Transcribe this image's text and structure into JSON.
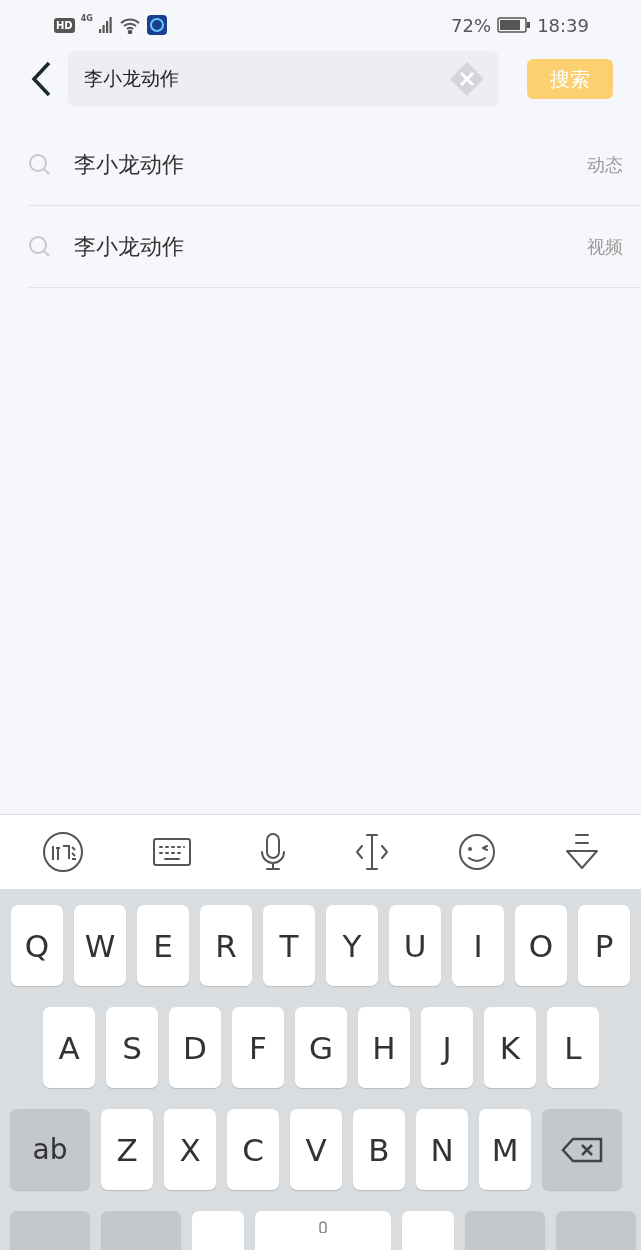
{
  "status_bar": {
    "hd": "HD",
    "network": "4G",
    "battery": "72%",
    "time": "18:39"
  },
  "search": {
    "value": "李小龙动作",
    "button": {
      "label": "搜索",
      "disabled": true
    }
  },
  "results": [
    {
      "text": "李小龙动作",
      "category": "动态"
    },
    {
      "text": "李小龙动作",
      "category": "视频"
    }
  ],
  "keyboard": {
    "rows": [
      [
        {
          "kind": "letter",
          "label": "Q"
        },
        {
          "kind": "letter",
          "label": "W"
        },
        {
          "kind": "letter",
          "label": "E"
        },
        {
          "kind": "letter",
          "label": "R"
        },
        {
          "kind": "letter",
          "label": "T"
        },
        {
          "kind": "letter",
          "label": "Y"
        },
        {
          "kind": "letter",
          "label": "U"
        },
        {
          "kind": "letter",
          "label": "I"
        },
        {
          "kind": "letter",
          "label": "O"
        },
        {
          "kind": "letter",
          "label": "P"
        }
      ],
      [
        {
          "kind": "letter",
          "label": "A"
        },
        {
          "kind": "letter",
          "label": "S"
        },
        {
          "kind": "letter",
          "label": "D"
        },
        {
          "kind": "letter",
          "label": "F"
        },
        {
          "kind": "letter",
          "label": "G"
        },
        {
          "kind": "letter",
          "label": "H"
        },
        {
          "kind": "letter",
          "label": "J"
        },
        {
          "kind": "letter",
          "label": "K"
        },
        {
          "kind": "letter",
          "label": "L"
        }
      ],
      [
        {
          "kind": "function",
          "label": "ab"
        },
        {
          "kind": "letter",
          "label": "Z"
        },
        {
          "kind": "letter",
          "label": "X"
        },
        {
          "kind": "letter",
          "label": "C"
        },
        {
          "kind": "letter",
          "label": "V"
        },
        {
          "kind": "letter",
          "label": "B"
        },
        {
          "kind": "letter",
          "label": "N"
        },
        {
          "kind": "letter",
          "label": "M"
        },
        {
          "kind": "backspace"
        }
      ],
      [
        {
          "kind": "function"
        },
        {
          "kind": "function"
        },
        {
          "kind": "blank"
        },
        {
          "kind": "space"
        },
        {
          "kind": "blank"
        },
        {
          "kind": "function"
        },
        {
          "kind": "function"
        }
      ]
    ]
  }
}
